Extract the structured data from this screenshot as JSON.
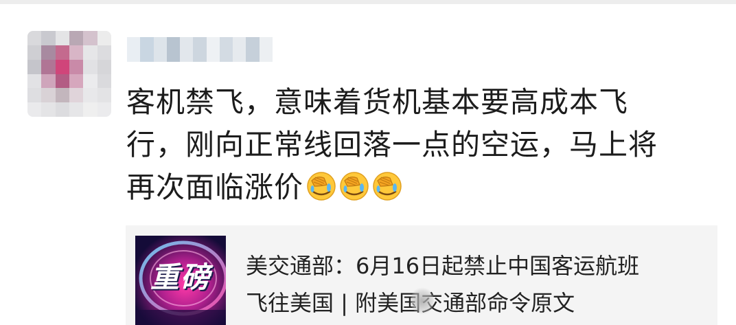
{
  "post": {
    "author_avatar": "blurred-avatar",
    "author_name": "",
    "text_lines": [
      "客机禁飞，意味着货机基本要高成本飞",
      "行，刚向正常线回落一点的空运，马上将",
      "再次面临涨价"
    ],
    "reactions": [
      "facepalm-cry-emoji",
      "facepalm-cry-emoji",
      "facepalm-cry-emoji"
    ]
  },
  "link_card": {
    "thumbnail_text": "重磅",
    "title_lines": [
      "美交通部：6月16日起禁止中国客运航班",
      "飞往美国 | 附美国交通部命令原文"
    ]
  },
  "colors": {
    "card_background": "#f4f4f4",
    "text": "#1c1c1c",
    "emoji_yellow": "#ffc83a",
    "thumbnail_magenta": "#e0208a"
  }
}
